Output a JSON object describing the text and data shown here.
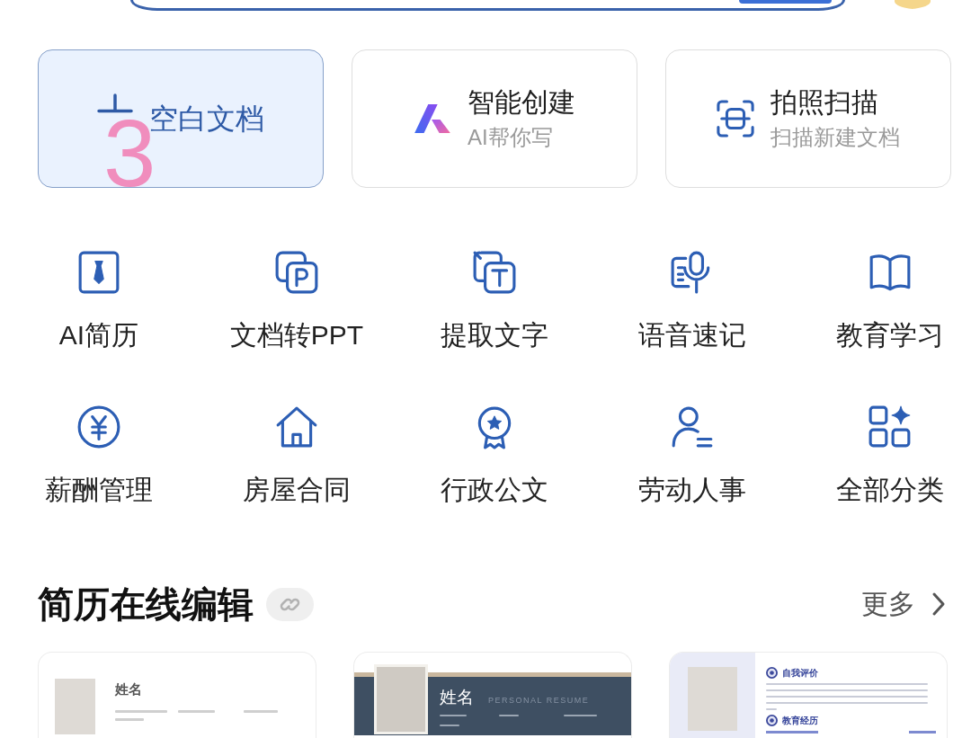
{
  "create_cards": [
    {
      "kind": "blank",
      "title": "空白文档",
      "selected": true
    },
    {
      "kind": "ai",
      "title": "智能创建",
      "subtitle": "AI帮你写",
      "selected": false
    },
    {
      "kind": "scan",
      "title": "拍照扫描",
      "subtitle": "扫描新建文档",
      "selected": false
    }
  ],
  "step_marker": "3",
  "tools": [
    {
      "kind": "resume",
      "label": "AI简历"
    },
    {
      "kind": "ppt",
      "label": "文档转PPT"
    },
    {
      "kind": "extract",
      "label": "提取文字"
    },
    {
      "kind": "voice",
      "label": "语音速记"
    },
    {
      "kind": "education",
      "label": "教育学习"
    },
    {
      "kind": "salary",
      "label": "薪酬管理"
    },
    {
      "kind": "house",
      "label": "房屋合同"
    },
    {
      "kind": "official",
      "label": "行政公文"
    },
    {
      "kind": "labor",
      "label": "劳动人事"
    },
    {
      "kind": "all",
      "label": "全部分类"
    }
  ],
  "resume_section": {
    "title": "简历在线编辑",
    "more": "更多",
    "templates": [
      {
        "kind": "classic",
        "name": "姓名"
      },
      {
        "kind": "banner",
        "name": "姓名",
        "subtitle": "PERSONAL RESUME"
      },
      {
        "kind": "sidebar",
        "sections": [
          "自我评价",
          "教育经历"
        ]
      }
    ]
  }
}
